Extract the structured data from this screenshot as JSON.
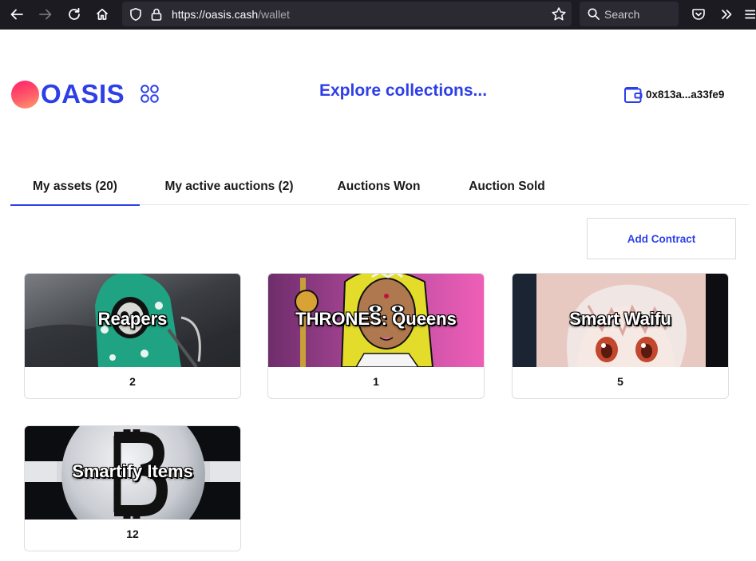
{
  "browser": {
    "url_host": "https://oasis.cash",
    "url_path": "/wallet",
    "search_placeholder": "Search"
  },
  "header": {
    "logo_text": "OASIS",
    "explore_label": "Explore collections...",
    "wallet_address": "0x813a...a33fe9"
  },
  "tabs": [
    {
      "label": "My assets (20)",
      "active": true
    },
    {
      "label": "My active auctions (2)",
      "active": false
    },
    {
      "label": "Auctions Won",
      "active": false
    },
    {
      "label": "Auction Sold",
      "active": false
    }
  ],
  "actions": {
    "add_contract_label": "Add Contract"
  },
  "collections": [
    {
      "name": "Reapers",
      "count": "2"
    },
    {
      "name": "THRONES: Queens",
      "count": "1"
    },
    {
      "name": "Smart Waifu",
      "count": "5"
    },
    {
      "name": "Smartify Items",
      "count": "12"
    }
  ],
  "colors": {
    "brand_blue": "#2e3fe8",
    "chrome_bg": "#1c1b22",
    "urlbar_bg": "#2b2a33"
  },
  "icons": {
    "back": "arrow-left-icon",
    "forward": "arrow-right-icon",
    "reload": "reload-icon",
    "home": "home-icon",
    "shield": "shield-icon",
    "lock": "lock-icon",
    "bookmark": "star-icon",
    "search": "search-icon",
    "pocket": "pocket-icon",
    "overflow": "chevrons-right-icon",
    "menu": "hamburger-menu-icon",
    "grid": "grid-icon",
    "wallet": "wallet-icon"
  }
}
